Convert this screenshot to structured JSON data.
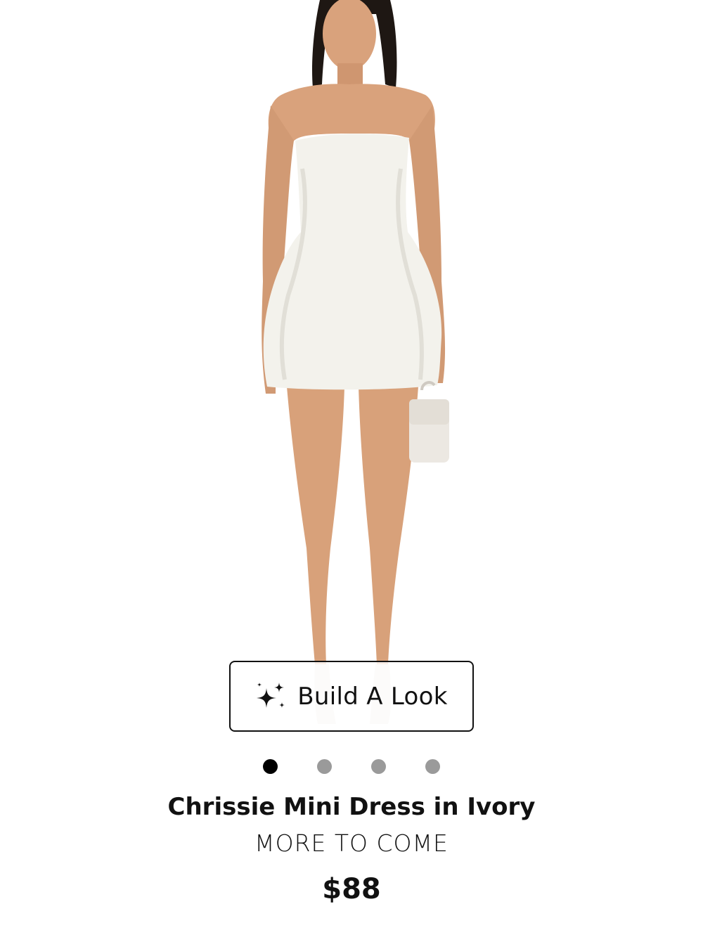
{
  "product": {
    "image_alt": "Model wearing ivory strapless mini dress",
    "title": "Chrissie Mini Dress in Ivory",
    "brand": "MORE TO COME",
    "price": "$88"
  },
  "build_look": {
    "label": "Build A Look",
    "icon": "sparkles-icon"
  },
  "carousel": {
    "total": 4,
    "active_index": 0
  },
  "colors": {
    "text": "#111111",
    "dot_active": "#000000",
    "dot_inactive": "#9a9a9a",
    "dress": "#f3f2ec",
    "skin": "#d9a27c",
    "hair": "#1e1713"
  }
}
